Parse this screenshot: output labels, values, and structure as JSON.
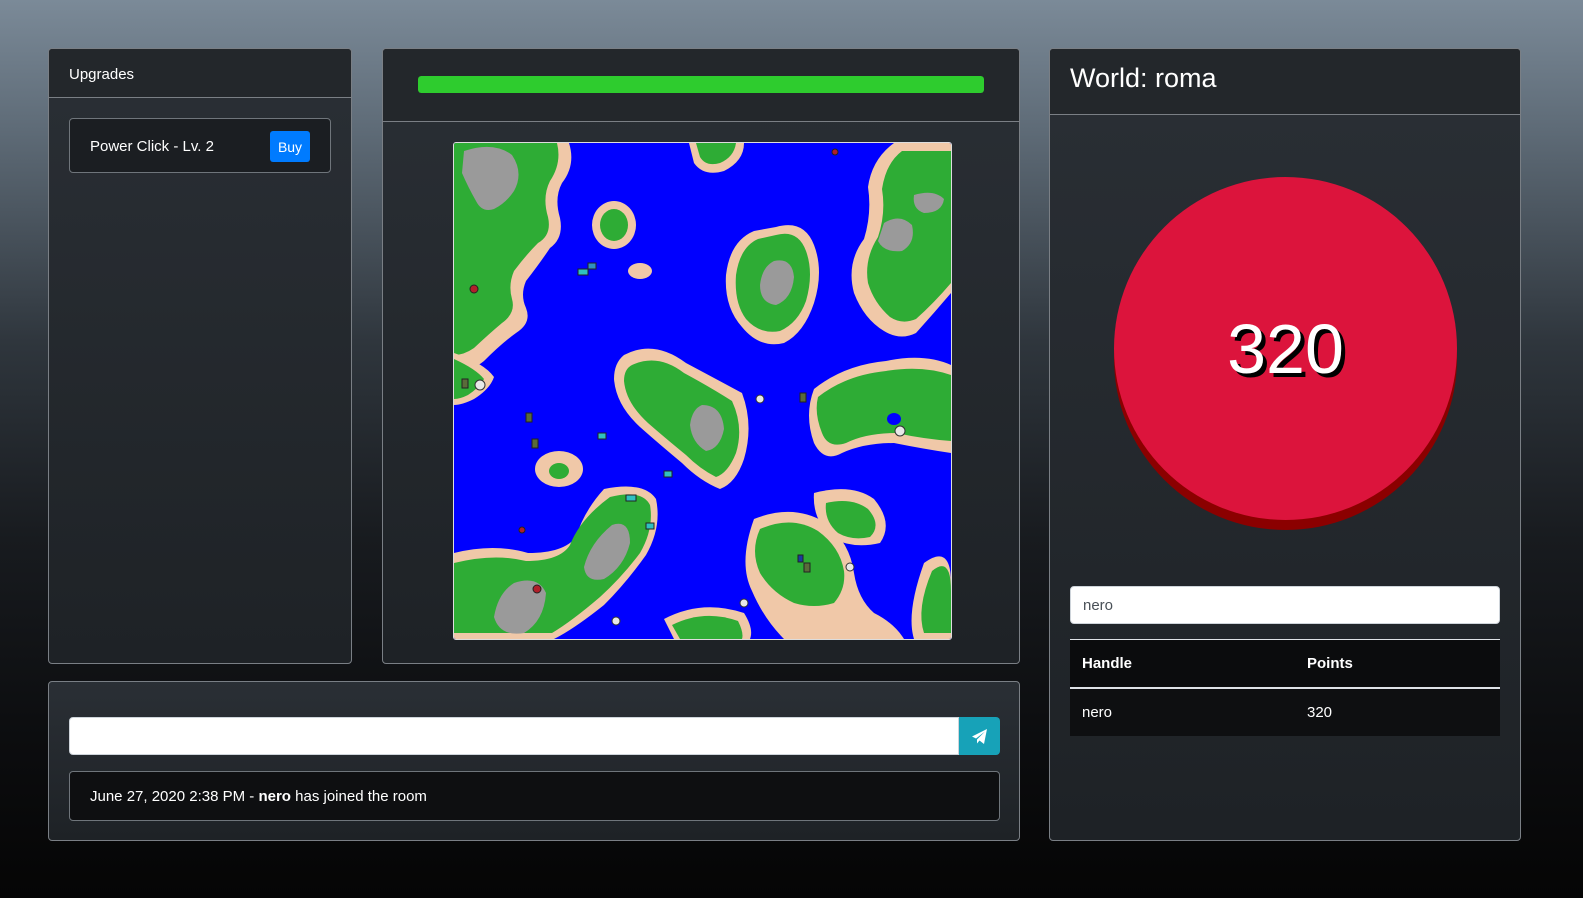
{
  "upgrades": {
    "title": "Upgrades",
    "items": [
      {
        "label": "Power Click - Lv. 2",
        "button_label": "Buy"
      }
    ]
  },
  "map": {
    "progress_fraction": 1.0,
    "progress_color": "#2ecc2e",
    "colors": {
      "water": "#0000ff",
      "grass": "#2eac35",
      "sand": "#f0c8a8",
      "rock": "#9a9a9a"
    }
  },
  "chat": {
    "input_value": "",
    "input_placeholder": "",
    "send_icon": "paper-plane-icon",
    "messages": [
      {
        "timestamp": "June 27, 2020 2:38 PM",
        "separator": " - ",
        "user": "nero",
        "text": " has joined the room"
      }
    ]
  },
  "world": {
    "title": "World: roma",
    "click_count": "320",
    "button_color": "#dc143c",
    "handle_input_value": "nero",
    "table": {
      "headers": [
        "Handle",
        "Points"
      ],
      "rows": [
        [
          "nero",
          "320"
        ]
      ]
    }
  }
}
